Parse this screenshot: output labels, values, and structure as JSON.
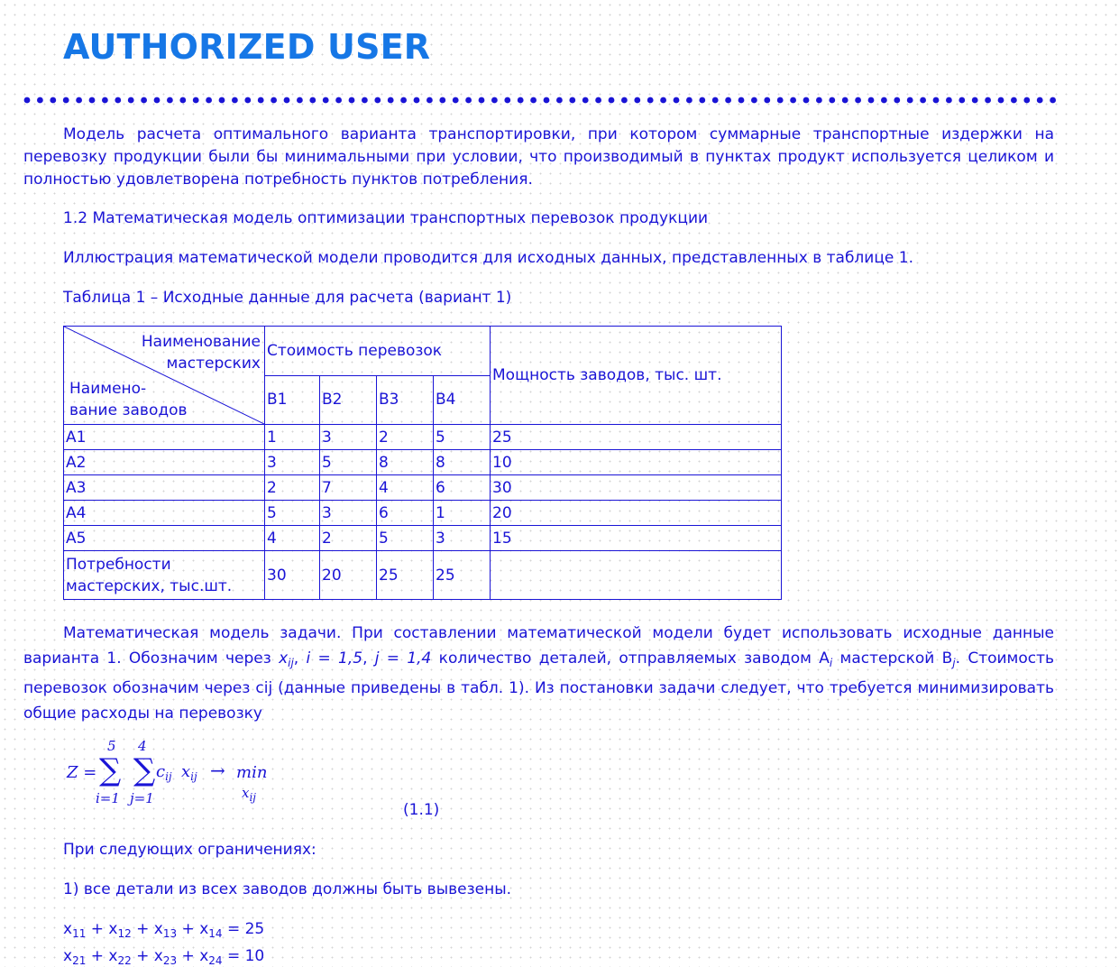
{
  "header": {
    "title": "AUTHORIZED USER"
  },
  "intro": "Модель расчета оптимального варианта транспортировки, при котором суммарные транспортные издержки на перевозку продукции были бы минимальными при условии, что производимый в пунктах продукт используется целиком и полностью удовлетворена потребность пунктов потребления.",
  "section_heading": "1.2 Математическая модель оптимизации транспортных перевозок продукции",
  "illustration_text": "Иллюстрация математической модели проводится для исходных данных, представленных в таблице 1.",
  "table_caption": "Таблица 1 – Исходные данные для расчета (вариант 1)",
  "table": {
    "corner_top_line1": "Наименование",
    "corner_top_line2": "мастерских",
    "corner_bottom_line1": "Наимено-",
    "corner_bottom_line2": "вание заводов",
    "cost_header": "Стоимость перевозок",
    "capacity_header": "Мощность заводов, тыс. шт.",
    "col_headers": [
      "B1",
      "B2",
      "B3",
      "B4"
    ],
    "rows": [
      {
        "name": "A1",
        "costs": [
          "1",
          "3",
          "2",
          "5"
        ],
        "capacity": "25"
      },
      {
        "name": "A2",
        "costs": [
          "3",
          "5",
          "8",
          "8"
        ],
        "capacity": "10"
      },
      {
        "name": "A3",
        "costs": [
          "2",
          "7",
          "4",
          "6"
        ],
        "capacity": "30"
      },
      {
        "name": "A4",
        "costs": [
          "5",
          "3",
          "6",
          "1"
        ],
        "capacity": "20"
      },
      {
        "name": "A5",
        "costs": [
          "4",
          "2",
          "5",
          "3"
        ],
        "capacity": "15"
      }
    ],
    "demand_label_line1": "Потребности",
    "demand_label_line2": "мастерских, тыс.шт.",
    "demand": [
      "30",
      "20",
      "25",
      "25"
    ]
  },
  "model": {
    "part1": "Математическая модель задачи. При составлении математической модели будет использовать исходные данные варианта 1. Обозначим через ",
    "var_x": "x",
    "var_x_sub": "ij",
    "part2": ", ",
    "i_range": "i  =  1,5",
    "part3": ", ",
    "j_range": "j  =  1,4",
    "part4": " количество деталей, отправляемых заводом A",
    "a_sub": "i",
    "part5": " мастерской B",
    "b_sub": "j",
    "part6": ". Стоимость перевозок обозначим через ",
    "cij": "cij",
    "part7": " (данные приведены в табл. 1). Из постановки задачи следует, что требуется минимизировать общие расходы на перевозку"
  },
  "formula": {
    "lhs": "Z =",
    "sum1_upper": "5",
    "sum1_lower": "i=1",
    "sum2_upper": "4",
    "sum2_lower": "j=1",
    "sigma": "∑",
    "c": "c",
    "c_sub": "ij",
    "x": "x",
    "x_sub": "ij",
    "arrow": "→",
    "min": "min",
    "min_sub": "x",
    "min_sub_sub": "ij",
    "number": "(1.1)"
  },
  "constraints_intro": "При следующих ограничениях:",
  "constraint1_text": "1) все детали из всех заводов должны быть вывезены.",
  "eq1": {
    "terms": [
      "x",
      "11",
      " + x",
      "12",
      " + x",
      "13",
      " + x",
      "14",
      " = 25"
    ]
  },
  "eq2": {
    "terms": [
      "x",
      "21",
      " + x",
      "22",
      " + x",
      "23",
      " + x",
      "24",
      " = 10"
    ]
  }
}
